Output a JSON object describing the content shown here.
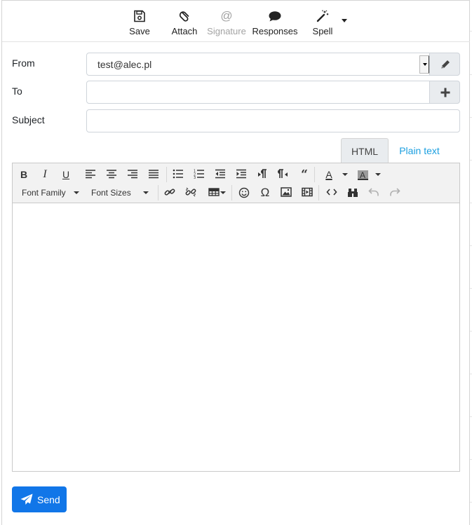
{
  "toolbar": {
    "save": "Save",
    "attach": "Attach",
    "signature": "Signature",
    "responses": "Responses",
    "spell": "Spell"
  },
  "form": {
    "from_label": "From",
    "from_value": "test@alec.pl",
    "to_label": "To",
    "to_value": "",
    "subject_label": "Subject",
    "subject_value": ""
  },
  "editor_tabs": {
    "html": "HTML",
    "plain": "Plain text",
    "active": "HTML"
  },
  "editor_toolbar": {
    "bold": "B",
    "italic": "I",
    "underline": "U",
    "font_family": "Font Family",
    "font_sizes": "Font Sizes",
    "quote": "66"
  },
  "send": {
    "label": "Send"
  },
  "colors": {
    "accent": "#1176e8",
    "link": "#1b9fe0",
    "disabled": "#a3a3a3"
  }
}
